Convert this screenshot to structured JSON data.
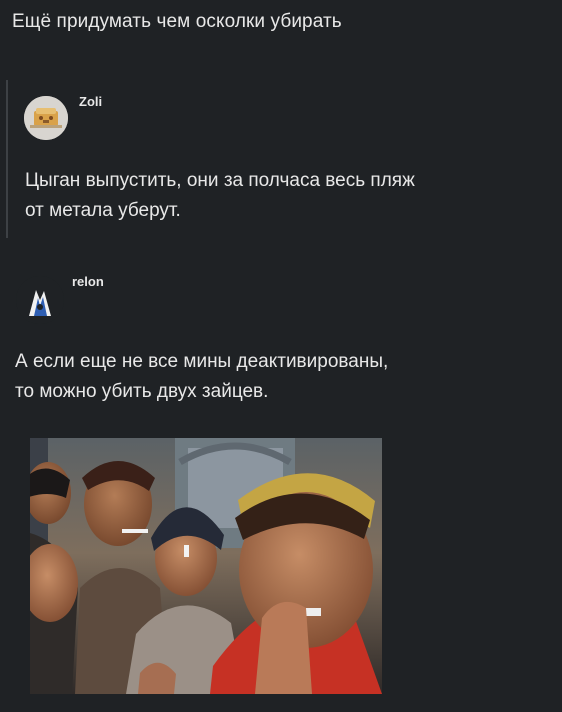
{
  "post": {
    "text": "Ещё придумать чем осколки убирать"
  },
  "quoted_comment": {
    "username": "Zoli",
    "text": "Цыган выпустить, они за полчаса весь пляж\nот метала уберут."
  },
  "reply_comment": {
    "username": "relon",
    "text": "А если еще не все мины деактивированы,\nто можно убить двух зайцев."
  },
  "attachment": {
    "kind": "photo"
  }
}
